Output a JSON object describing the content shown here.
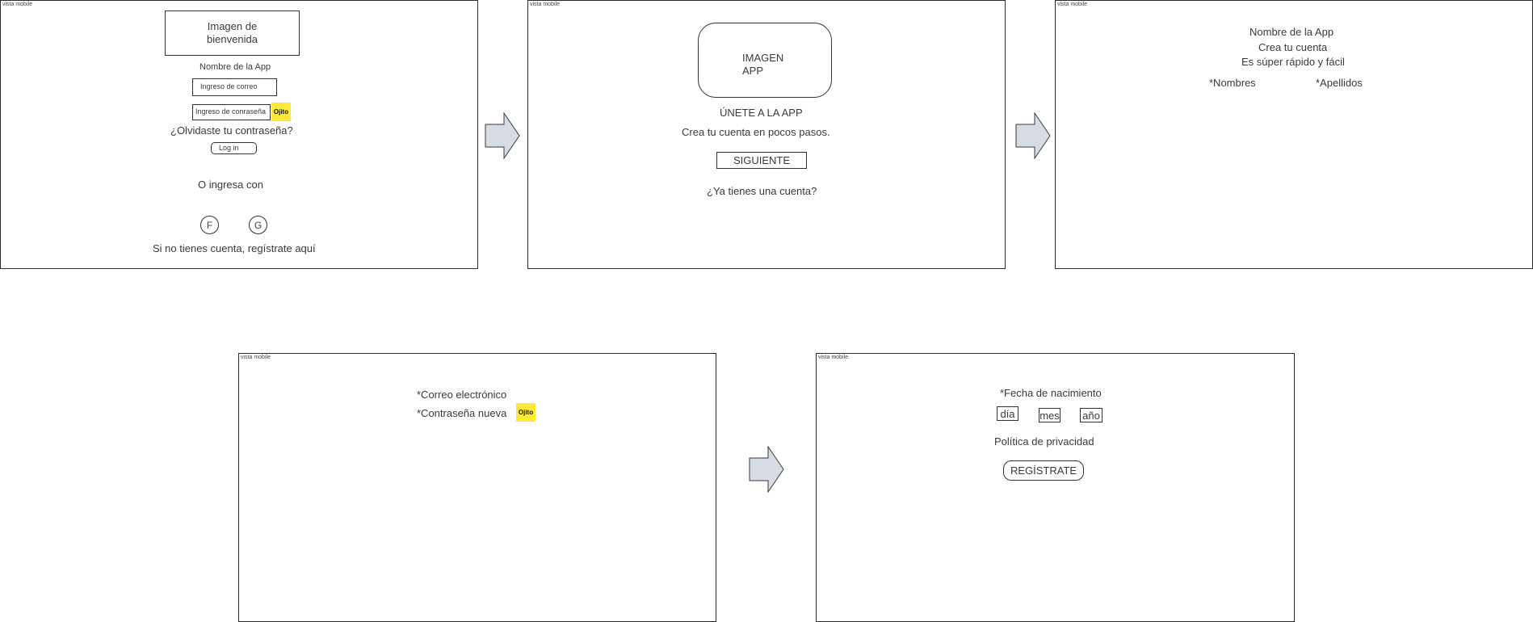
{
  "frame_label": "vista mobile",
  "screen1": {
    "welcome_image": "Imagen de\nbienvenida",
    "app_name": "Nombre de la App",
    "email_input": "Ingreso de correo",
    "password_input": "Ingreso de conraseña",
    "ojito": "Ojito",
    "forgot_password": "¿Olvidaste tu contraseña?",
    "login_button": "Log in",
    "or_login_with": "O ingresa con",
    "facebook": "F",
    "google": "G",
    "register_here": "Si no tienes cuenta, regístrate aquí"
  },
  "screen2": {
    "app_image": "IMAGEN\nAPP",
    "join_title": "ÚNETE A LA APP",
    "subtitle": "Crea tu cuenta en pocos pasos.",
    "next_button": "SIGUIENTE",
    "have_account": "¿Ya tienes una cuenta?"
  },
  "screen3": {
    "app_name": "Nombre de la App",
    "create_account": "Crea tu cuenta",
    "fast_easy": "Es súper rápido y fácil",
    "first_names": "*Nombres",
    "last_names": "*Apellidos"
  },
  "screen4": {
    "email": "*Correo electrónico",
    "new_password": "*Contraseña nueva",
    "ojito": "Ojito"
  },
  "screen5": {
    "birth_date": "*Fecha de nacimiento",
    "day": "día",
    "month": "mes",
    "year": "año",
    "privacy_policy": "Política de privacidad",
    "register_button": "REGÍSTRATE"
  },
  "colors": {
    "ojito_highlight": "#ffe93b",
    "arrow_fill": "#d6dbe4",
    "border": "#2b2b2b"
  }
}
